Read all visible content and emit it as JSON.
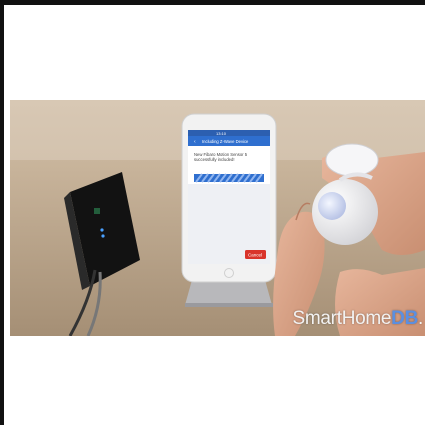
{
  "phone_screen": {
    "status_time": "13:10",
    "header_title": "Including Z-Wave Device",
    "message": "New Fibaro Motion Sensor 5 successfully included!",
    "cancel_label": "Cancel"
  },
  "watermark": {
    "prefix": "SmartHome",
    "suffix": "DB",
    "dot": "."
  },
  "colors": {
    "header_blue": "#2f6fcf",
    "cancel_red": "#d9342b",
    "db_blue": "#5b8fe0"
  }
}
